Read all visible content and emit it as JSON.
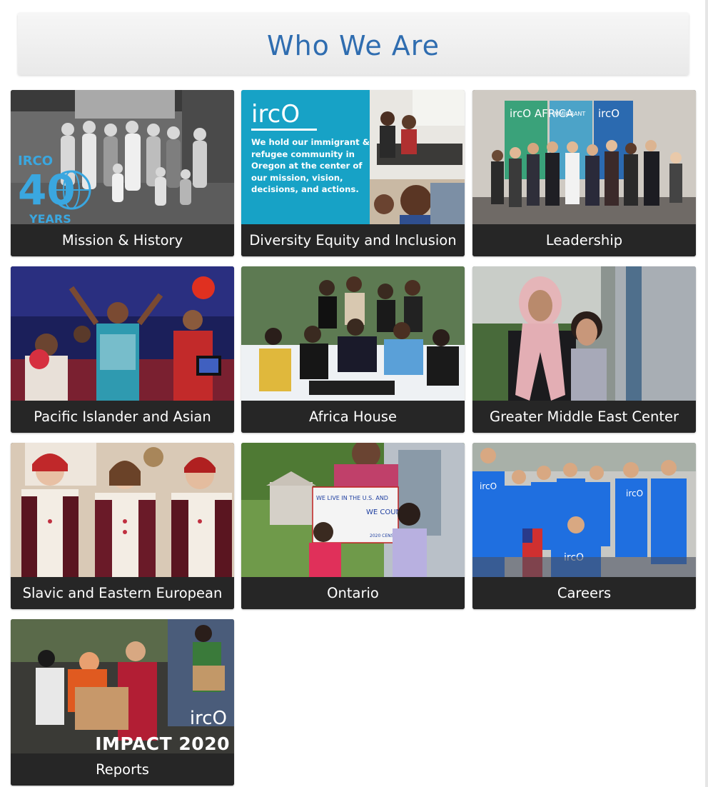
{
  "page": {
    "title": "Who We Are"
  },
  "cards": [
    {
      "label": "Mission & History",
      "badge_top": "IRCO",
      "badge_number": "40",
      "badge_bottom": "YEARS"
    },
    {
      "label": "Diversity Equity and Inclusion",
      "logo": "ircO",
      "statement": "We hold our immigrant & refugee community in Oregon at the center of our mission, vision, decisions, and actions."
    },
    {
      "label": "Leadership",
      "banner_1": "ircO AFRICA",
      "banner_2": "IMMIGRANT",
      "banner_3": "ircO"
    },
    {
      "label": "Pacific Islander and Asian"
    },
    {
      "label": "Africa House"
    },
    {
      "label": "Greater Middle East Center"
    },
    {
      "label": "Slavic and Eastern European"
    },
    {
      "label": "Ontario",
      "sign_line_1": "WE LIVE IN THE U.S. AND",
      "sign_line_2": "WE COUNT",
      "sign_line_3": "2020 CENSUS"
    },
    {
      "label": "Careers",
      "shirt_logo": "ircO"
    },
    {
      "label": "Reports",
      "logo": "ircO",
      "impact_text": "IMPACT 2020"
    }
  ],
  "colors": {
    "title": "#2f6db0",
    "label_bar": "#262626",
    "dei_panel": "#17a2c6",
    "shirt_blue": "#1f6fe0"
  }
}
